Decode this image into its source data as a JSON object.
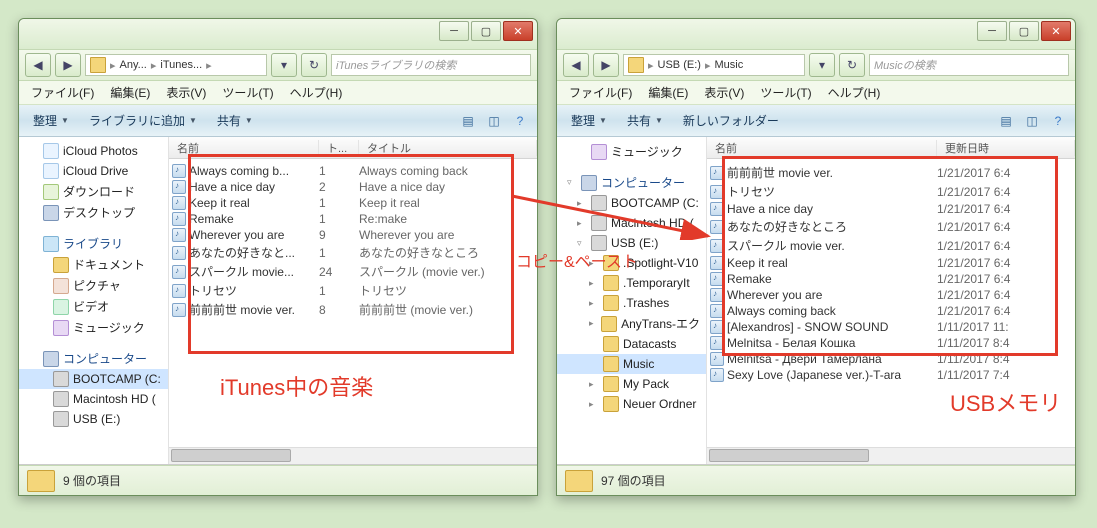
{
  "annotations": {
    "left_label": "iTunes中の音楽",
    "right_label": "USBメモリ",
    "middle_label": "コピー&ペースト"
  },
  "left": {
    "nav_back": "◀",
    "nav_fwd": "▶",
    "breadcrumb": [
      "Any...",
      "iTunes..."
    ],
    "search_placeholder": "iTunesライブラリの検索",
    "menubar": [
      "ファイル(F)",
      "編集(E)",
      "表示(V)",
      "ツール(T)",
      "ヘルプ(H)"
    ],
    "toolbar": {
      "organize": "整理",
      "add_library": "ライブラリに追加",
      "share": "共有"
    },
    "sidebar": [
      {
        "icon": "cloud",
        "label": "iCloud Photos"
      },
      {
        "icon": "cloud",
        "label": "iCloud Drive"
      },
      {
        "icon": "dl",
        "label": "ダウンロード"
      },
      {
        "icon": "pc",
        "label": "デスクトップ"
      },
      {
        "spacer": true
      },
      {
        "icon": "lib",
        "label": "ライブラリ",
        "bold": true
      },
      {
        "icon": "folder",
        "label": "ドキュメント",
        "indent": 1
      },
      {
        "icon": "pic",
        "label": "ピクチャ",
        "indent": 1
      },
      {
        "icon": "vid",
        "label": "ビデオ",
        "indent": 1
      },
      {
        "icon": "music",
        "label": "ミュージック",
        "indent": 1
      },
      {
        "spacer": true
      },
      {
        "icon": "pc",
        "label": "コンピューター",
        "bold": true
      },
      {
        "icon": "drive",
        "label": "BOOTCAMP (C:",
        "indent": 1,
        "sel": true
      },
      {
        "icon": "drive",
        "label": "Macintosh HD (",
        "indent": 1
      },
      {
        "icon": "drive",
        "label": "USB (E:)",
        "indent": 1
      }
    ],
    "columns": {
      "name": "名前",
      "track": "ト...",
      "title": "タイトル"
    },
    "files": [
      {
        "name": "Always coming b...",
        "track": "1",
        "title": "Always coming back"
      },
      {
        "name": "Have a nice day",
        "track": "2",
        "title": "Have a nice day"
      },
      {
        "name": "Keep it real",
        "track": "1",
        "title": "Keep it real"
      },
      {
        "name": "Remake",
        "track": "1",
        "title": "Re:make"
      },
      {
        "name": "Wherever you are",
        "track": "9",
        "title": "Wherever you are"
      },
      {
        "name": "あなたの好きなと...",
        "track": "1",
        "title": "あなたの好きなところ"
      },
      {
        "name": "スパークル movie...",
        "track": "24",
        "title": "スパークル (movie ver.)"
      },
      {
        "name": "トリセツ",
        "track": "1",
        "title": "トリセツ"
      },
      {
        "name": "前前前世 movie ver.",
        "track": "8",
        "title": "前前前世 (movie ver.)"
      }
    ],
    "status": "9 個の項目"
  },
  "right": {
    "breadcrumb": [
      "USB (E:)",
      "Music"
    ],
    "search_placeholder": "Musicの検索",
    "menubar": [
      "ファイル(F)",
      "編集(E)",
      "表示(V)",
      "ツール(T)",
      "ヘルプ(H)"
    ],
    "toolbar": {
      "organize": "整理",
      "share": "共有",
      "newfolder": "新しいフォルダー"
    },
    "sidebar": [
      {
        "icon": "music",
        "label": "ミュージック",
        "indent": 1
      },
      {
        "spacer": true
      },
      {
        "icon": "pc",
        "label": "コンピューター",
        "bold": true,
        "twisty": "▿"
      },
      {
        "icon": "drive",
        "label": "BOOTCAMP (C:",
        "indent": 1,
        "twisty": "▸"
      },
      {
        "icon": "drive",
        "label": "Macintosh HD (",
        "indent": 1,
        "twisty": "▸"
      },
      {
        "icon": "drive",
        "label": "USB (E:)",
        "indent": 1,
        "twisty": "▿"
      },
      {
        "icon": "folder",
        "label": ".Spotlight-V10",
        "indent": 2,
        "twisty": "▸"
      },
      {
        "icon": "folder",
        "label": ".TemporaryIt",
        "indent": 2,
        "twisty": "▸"
      },
      {
        "icon": "folder",
        "label": ".Trashes",
        "indent": 2,
        "twisty": "▸"
      },
      {
        "icon": "folder",
        "label": "AnyTrans-エク",
        "indent": 2,
        "twisty": "▸"
      },
      {
        "icon": "folder",
        "label": "Datacasts",
        "indent": 2
      },
      {
        "icon": "folder",
        "label": "Music",
        "indent": 2,
        "sel": true
      },
      {
        "icon": "folder",
        "label": "My Pack",
        "indent": 2,
        "twisty": "▸"
      },
      {
        "icon": "folder",
        "label": "Neuer Ordner",
        "indent": 2,
        "twisty": "▸"
      }
    ],
    "columns": {
      "name": "名前",
      "date": "更新日時"
    },
    "files": [
      {
        "name": "前前前世 movie ver.",
        "date": "1/21/2017 6:4"
      },
      {
        "name": "トリセツ",
        "date": "1/21/2017 6:4"
      },
      {
        "name": "Have a nice day",
        "date": "1/21/2017 6:4"
      },
      {
        "name": "あなたの好きなところ",
        "date": "1/21/2017 6:4"
      },
      {
        "name": "スパークル movie ver.",
        "date": "1/21/2017 6:4"
      },
      {
        "name": "Keep it real",
        "date": "1/21/2017 6:4"
      },
      {
        "name": "Remake",
        "date": "1/21/2017 6:4"
      },
      {
        "name": "Wherever you are",
        "date": "1/21/2017 6:4"
      },
      {
        "name": "Always coming back",
        "date": "1/21/2017 6:4"
      },
      {
        "name": "[Alexandros] - SNOW SOUND",
        "date": "1/11/2017 11:"
      },
      {
        "name": "Melnitsa - Белая Кошка",
        "date": "1/11/2017 8:4"
      },
      {
        "name": "Melnitsa - Двери Тамерлана",
        "date": "1/11/2017 8:4"
      },
      {
        "name": "Sexy Love (Japanese ver.)-T-ara",
        "date": "1/11/2017 7:4"
      }
    ],
    "status": "97 個の項目"
  }
}
